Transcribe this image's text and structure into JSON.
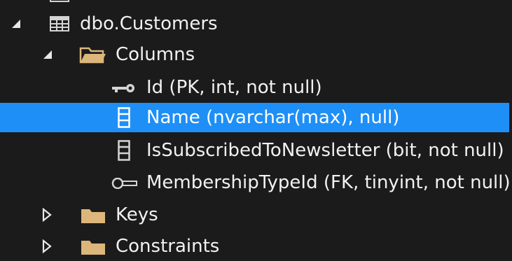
{
  "tree": {
    "nodes": [
      {
        "id": "top-partial",
        "label": "",
        "icon": "table-icon",
        "expanded": null
      },
      {
        "id": "dbo-customers",
        "label": "dbo.Customers",
        "icon": "table-icon",
        "expanded": true
      },
      {
        "id": "columns-folder",
        "label": "Columns",
        "icon": "open-folder-icon",
        "expanded": true
      },
      {
        "id": "col-id",
        "label": "Id (PK, int, not null)",
        "icon": "primary-key-icon"
      },
      {
        "id": "col-name",
        "label": "Name (nvarchar(max), null)",
        "icon": "column-icon",
        "selected": true
      },
      {
        "id": "col-subscribed",
        "label": "IsSubscribedToNewsletter (bit, not null)",
        "icon": "column-icon"
      },
      {
        "id": "col-membership",
        "label": "MembershipTypeId (FK, tinyint, not null)",
        "icon": "foreign-key-icon"
      },
      {
        "id": "keys-folder",
        "label": "Keys",
        "icon": "folder-icon",
        "expanded": false
      },
      {
        "id": "constraints-folder",
        "label": "Constraints",
        "icon": "folder-icon",
        "expanded": false
      }
    ]
  },
  "colors": {
    "background": "#1b1b1c",
    "selection": "#1e8ff7",
    "text": "#f1f1f1",
    "folder": "#dcb67a",
    "icon": "#d4d4d4"
  }
}
